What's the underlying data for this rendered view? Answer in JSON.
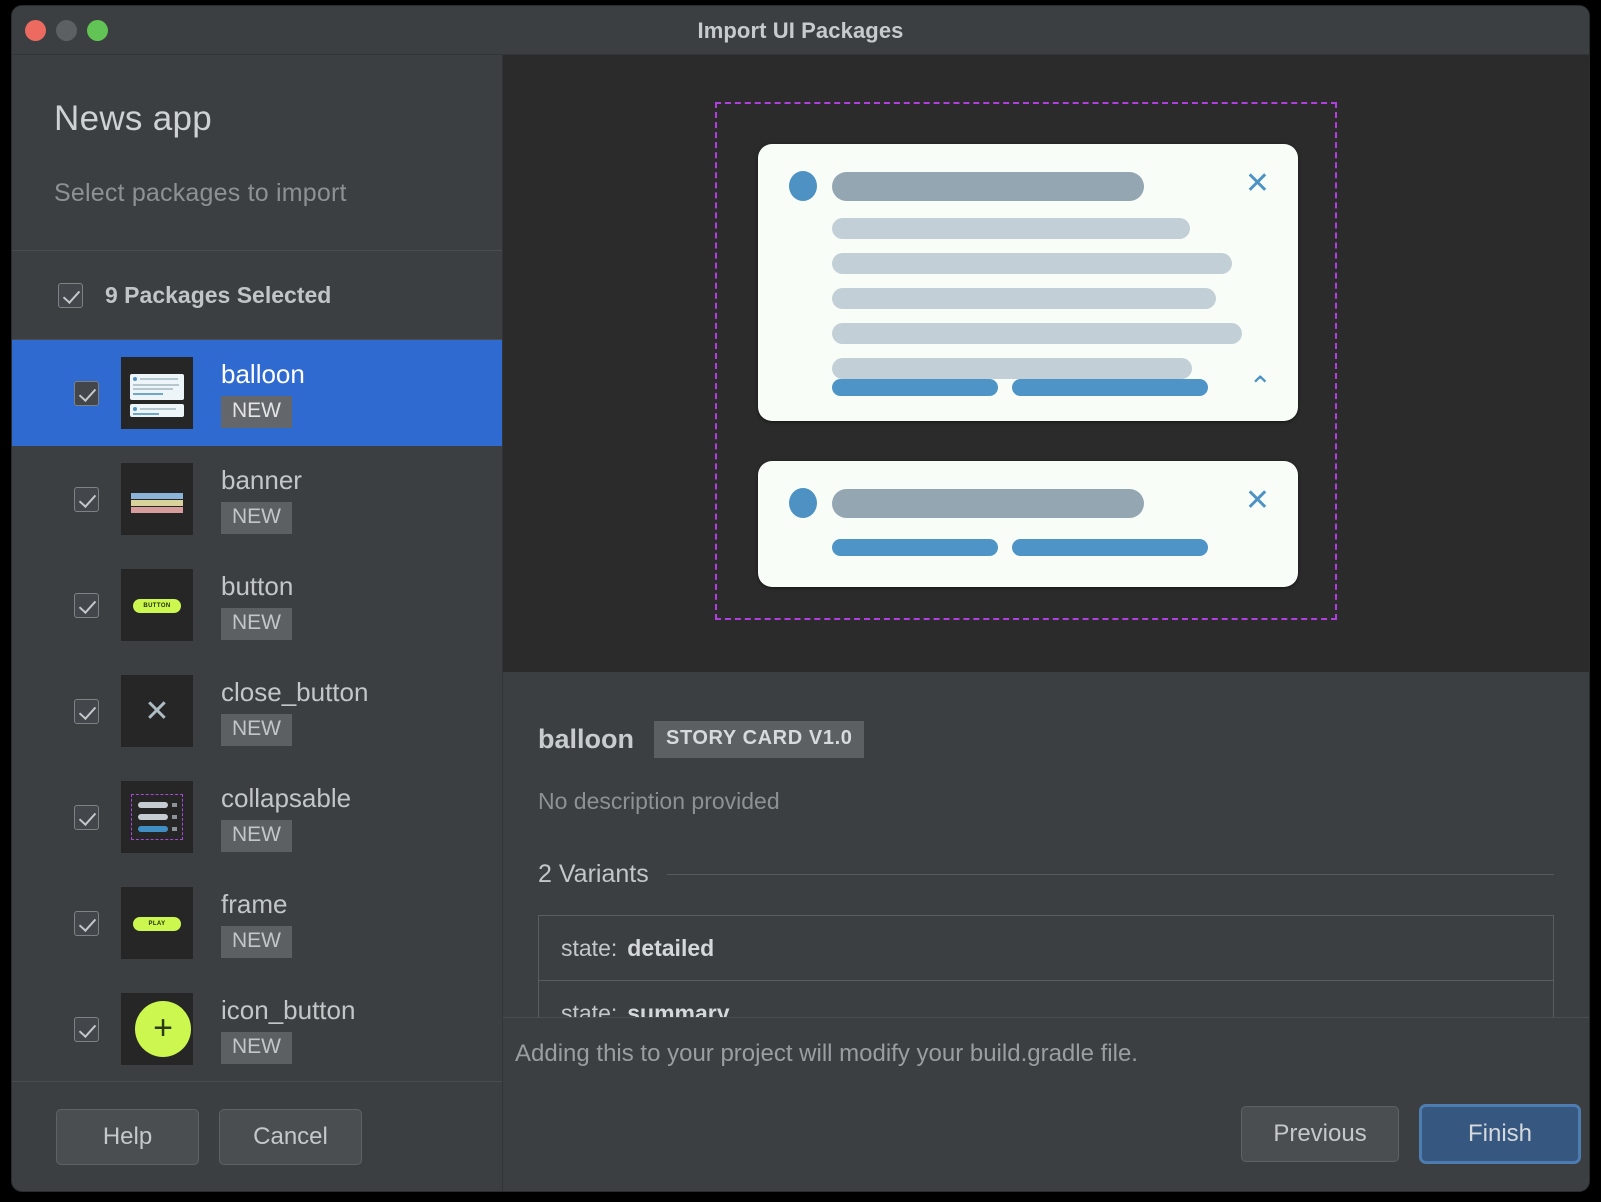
{
  "window": {
    "title": "Import UI Packages",
    "traffic_lights": [
      "close",
      "minimize",
      "zoom"
    ]
  },
  "sidebar": {
    "app_title": "News app",
    "subtitle": "Select packages to import",
    "select_all_label": "9 Packages Selected",
    "select_all_checked": true,
    "packages": [
      {
        "name": "balloon",
        "badge": "NEW",
        "checked": true,
        "selected": true,
        "thumb": "story-card-thumb"
      },
      {
        "name": "banner",
        "badge": "NEW",
        "checked": true,
        "selected": false,
        "thumb": "banner-thumb"
      },
      {
        "name": "button",
        "badge": "NEW",
        "checked": true,
        "selected": false,
        "thumb": "button-pill-thumb",
        "pill_label": "BUTTON"
      },
      {
        "name": "close_button",
        "badge": "NEW",
        "checked": true,
        "selected": false,
        "thumb": "close-x-thumb"
      },
      {
        "name": "collapsable",
        "badge": "NEW",
        "checked": true,
        "selected": false,
        "thumb": "collapsable-thumb"
      },
      {
        "name": "frame",
        "badge": "NEW",
        "checked": true,
        "selected": false,
        "thumb": "frame-pill-thumb",
        "pill_label": "PLAY"
      },
      {
        "name": "icon_button",
        "badge": "NEW",
        "checked": true,
        "selected": false,
        "thumb": "icon-plus-thumb",
        "glyph": "+"
      }
    ],
    "footer_buttons": [
      {
        "label": "Help",
        "style": "default"
      },
      {
        "label": "Cancel",
        "style": "default"
      }
    ]
  },
  "preview": {
    "background_color": "#2b2b2b",
    "frame_border_color": "#b13ee0",
    "card_background": "#f8fdf8",
    "accent_color": "#4e94c6",
    "cards": [
      {
        "variant": "detailed",
        "close_icon": "✕",
        "expand_icon": "⌃",
        "text_lines": [
          312,
          358,
          400,
          384,
          410,
          360
        ],
        "actions": [
          166,
          196
        ]
      },
      {
        "variant": "summary",
        "close_icon": "✕",
        "text_lines": [
          312
        ],
        "actions": [
          166,
          196
        ]
      }
    ]
  },
  "details": {
    "name": "balloon",
    "tag": "STORY CARD V1.0",
    "description": "No description provided",
    "variants_header": "2 Variants",
    "variants": [
      {
        "key": "state:",
        "value": "detailed"
      },
      {
        "key": "state:",
        "value": "summary"
      }
    ]
  },
  "statusbar": {
    "message": "Adding this to your project will modify your build.gradle file.",
    "buttons": [
      {
        "label": "Previous",
        "style": "default"
      },
      {
        "label": "Finish",
        "style": "primary"
      }
    ]
  }
}
